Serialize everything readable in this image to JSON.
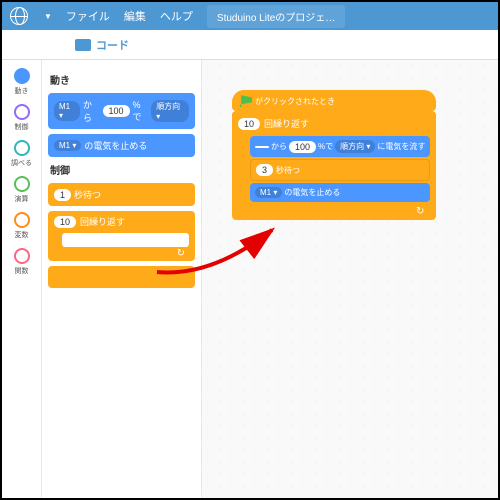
{
  "menu": {
    "file": "ファイル",
    "edit": "編集",
    "help": "ヘルプ",
    "project": "Studuino Liteのプロジェ…"
  },
  "tabs": {
    "code": "コード"
  },
  "categories": [
    {
      "label": "動き",
      "color": "filled-blue"
    },
    {
      "label": "制御",
      "color": "ring-purple"
    },
    {
      "label": "調べる",
      "color": "ring-teal"
    },
    {
      "label": "演算",
      "color": "ring-green"
    },
    {
      "label": "変数",
      "color": "ring-orange"
    },
    {
      "label": "関数",
      "color": "ring-pink"
    }
  ],
  "palette": {
    "motion_title": "動き",
    "motor_from": "M1 ▾",
    "from_text": "から",
    "power_val": "100",
    "pct": "%で",
    "dir": "順方向 ▾",
    "stop_motor": "M1 ▾",
    "stop_text": "の電気を止める",
    "control_title": "制御",
    "wait_val": "1",
    "wait_text": "秒待つ",
    "repeat_val": "10",
    "repeat_text": "回繰り返す"
  },
  "workspace": {
    "hat_text": "がクリックされたとき",
    "repeat_val": "10",
    "repeat_text": "回繰り返す",
    "blank": "",
    "from_text": "から",
    "power_val": "100",
    "pct": "%で",
    "dir": "順方向 ▾",
    "flow_text": "に電気を流す",
    "wait_val": "3",
    "wait_text": "秒待つ",
    "stop_motor": "M1 ▾",
    "stop_text": "の電気を止める"
  }
}
